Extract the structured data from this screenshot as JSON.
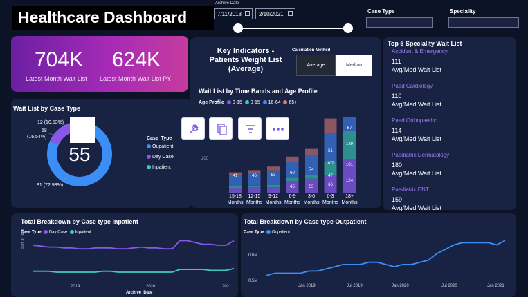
{
  "header": {
    "title": "Healthcare Dashboard",
    "archive_date_label": "Archive Date",
    "date_from": "7/11/2018",
    "date_to": "2/10/2021",
    "case_type_label": "Case Type",
    "speciality_label": "Speciality"
  },
  "kpis": [
    {
      "value": "704K",
      "label": "Latest Month Wait List"
    },
    {
      "value": "624K",
      "label": "Latest Month Wait List PY"
    }
  ],
  "key_indicators": {
    "title_line1": "Key Indicators -",
    "title_line2": "Patients Weight List",
    "title_line3": "(Average)",
    "calc_method_label": "Calculation Method",
    "btn_average": "Average",
    "btn_median": "Median"
  },
  "wait_list_case": {
    "title": "Wait List by Case Type",
    "center_value": "55",
    "legend_title": "Case_Type",
    "legend": [
      {
        "label": "Oupatient",
        "color": "#3a8ef6"
      },
      {
        "label": "Day Case",
        "color": "#8a57e8"
      },
      {
        "label": "Inpatient",
        "color": "#3ec9c0"
      }
    ],
    "callout_1": "12 (10.53%)",
    "callout_2a": "18",
    "callout_2b": "(16.54%)",
    "callout_3": "81 (72.93%)"
  },
  "time_bands": {
    "title": "Wait List by Time Bands and Age Profile",
    "legend_title": "Age Profile",
    "axis_tick": "200",
    "legend": [
      {
        "label": "0-15",
        "color": "#8a57e8"
      },
      {
        "label": "0-15",
        "color": "#3ec9c0"
      },
      {
        "label": "16-64",
        "color": "#3a8ef6"
      },
      {
        "label": "65+",
        "color": "#e07a73"
      }
    ],
    "cat_line1": [
      "15-18",
      "12-15",
      "9-12",
      "6-9",
      "3-6",
      "0-3",
      "18+"
    ],
    "cat_line2": [
      "Months",
      "Months",
      "Months",
      "Months",
      "Months",
      "Months",
      "Months"
    ],
    "labels": {
      "c0": "41",
      "c1": "46",
      "c2": "53",
      "c3a": "60",
      "c3b": "45",
      "c4a": "74",
      "c4b": "53",
      "c5a": "51",
      "c5b": "107",
      "c5c": "47",
      "c5d": "66",
      "c6a": "67",
      "c6b": "139",
      "c6c": "101",
      "c6d": "124"
    }
  },
  "chart_data": [
    {
      "type": "bar",
      "title": "Wait List by Time Bands and Age Profile",
      "categories": [
        "15-18 Months",
        "12-15 Months",
        "9-12 Months",
        "6-9 Months",
        "3-6 Months",
        "0-3 Months",
        "18+ Months"
      ],
      "series": [
        {
          "name": "0-15",
          "values": [
            20,
            22,
            22,
            45,
            53,
            66,
            124
          ]
        },
        {
          "name": "0-15",
          "values": [
            5,
            6,
            8,
            10,
            12,
            47,
            101
          ]
        },
        {
          "name": "16-64",
          "values": [
            41,
            46,
            53,
            60,
            74,
            107,
            139
          ]
        },
        {
          "name": "65+",
          "values": [
            10,
            10,
            14,
            18,
            22,
            51,
            67
          ]
        }
      ]
    },
    {
      "type": "pie",
      "title": "Wait List by Case Type",
      "categories": [
        "Oupatient",
        "Day Case",
        "Inpatient"
      ],
      "values": [
        81,
        18,
        12
      ]
    },
    {
      "type": "line",
      "title": "Total Breakdown by Case type Inpatient",
      "xlabel": "Archive_Date",
      "ylabel": "Sum of Total",
      "x_ticks": [
        "2019",
        "2020",
        "2021"
      ],
      "series": [
        {
          "name": "Day Case",
          "values": [
            0.55,
            0.54,
            0.53,
            0.53,
            0.52,
            0.52,
            0.51,
            0.51,
            0.52,
            0.52,
            0.52,
            0.51,
            0.51,
            0.52,
            0.53,
            0.52,
            0.52,
            0.51,
            0.51,
            0.6,
            0.6,
            0.58,
            0.56,
            0.56,
            0.55,
            0.55,
            0.6
          ]
        },
        {
          "name": "Inpatient",
          "values": [
            0.26,
            0.26,
            0.26,
            0.25,
            0.25,
            0.25,
            0.25,
            0.25,
            0.25,
            0.26,
            0.26,
            0.25,
            0.25,
            0.25,
            0.25,
            0.25,
            0.25,
            0.25,
            0.25,
            0.28,
            0.28,
            0.28,
            0.28,
            0.27,
            0.27,
            0.27,
            0.29
          ]
        }
      ]
    },
    {
      "type": "line",
      "title": "Total Breakdown by Case type Outpatient",
      "x_ticks": [
        "Jan 2019",
        "Jul 2019",
        "Jan 2020",
        "Jul 2020",
        "Jan 2021"
      ],
      "y_ticks": [
        "0.6M",
        "0.5M"
      ],
      "series": [
        {
          "name": "Oupatient",
          "values": [
            0.51,
            0.52,
            0.52,
            0.52,
            0.52,
            0.53,
            0.53,
            0.54,
            0.55,
            0.56,
            0.56,
            0.56,
            0.57,
            0.57,
            0.56,
            0.55,
            0.56,
            0.56,
            0.57,
            0.58,
            0.61,
            0.63,
            0.65,
            0.66,
            0.66,
            0.66,
            0.66,
            0.65,
            0.67
          ]
        }
      ]
    }
  ],
  "top5": {
    "title": "Top 5 Speciality Wait List",
    "sub_label": "Avg/Med Wait List",
    "items": [
      {
        "name": "Accident & Emergency",
        "value": "111"
      },
      {
        "name": "Paed Cardiology",
        "value": "110"
      },
      {
        "name": "Paed Orthopaedic",
        "value": "114"
      },
      {
        "name": "Paediatric Dermatology",
        "value": "180"
      },
      {
        "name": "Paediatric ENT",
        "value": "159"
      }
    ]
  },
  "inpatient": {
    "title": "Total Breakdown by Case type Inpatient",
    "legend_title": "Case Type",
    "legend": [
      {
        "label": "Day Case",
        "color": "#8a57e8"
      },
      {
        "label": "Inpatient",
        "color": "#3ec9c0"
      }
    ],
    "ylabel": "Sum of Total",
    "xlabel": "Archive_Date",
    "x_ticks": [
      "2019",
      "2020",
      "2021"
    ]
  },
  "outpatient": {
    "title": "Total Breakdown by Case type Outpatient",
    "legend_title": "Case Type",
    "legend": [
      {
        "label": "Oupatient",
        "color": "#3a8ef6"
      }
    ],
    "x_ticks": [
      "Jan 2019",
      "Jul 2019",
      "Jan 2020",
      "Jul 2020",
      "Jan 2021"
    ],
    "y_ticks": [
      "0.6M",
      "0.5M"
    ]
  },
  "toolbar": {
    "icons": [
      "pin-icon",
      "copy-icon",
      "filter-icon",
      "more-icon"
    ]
  }
}
